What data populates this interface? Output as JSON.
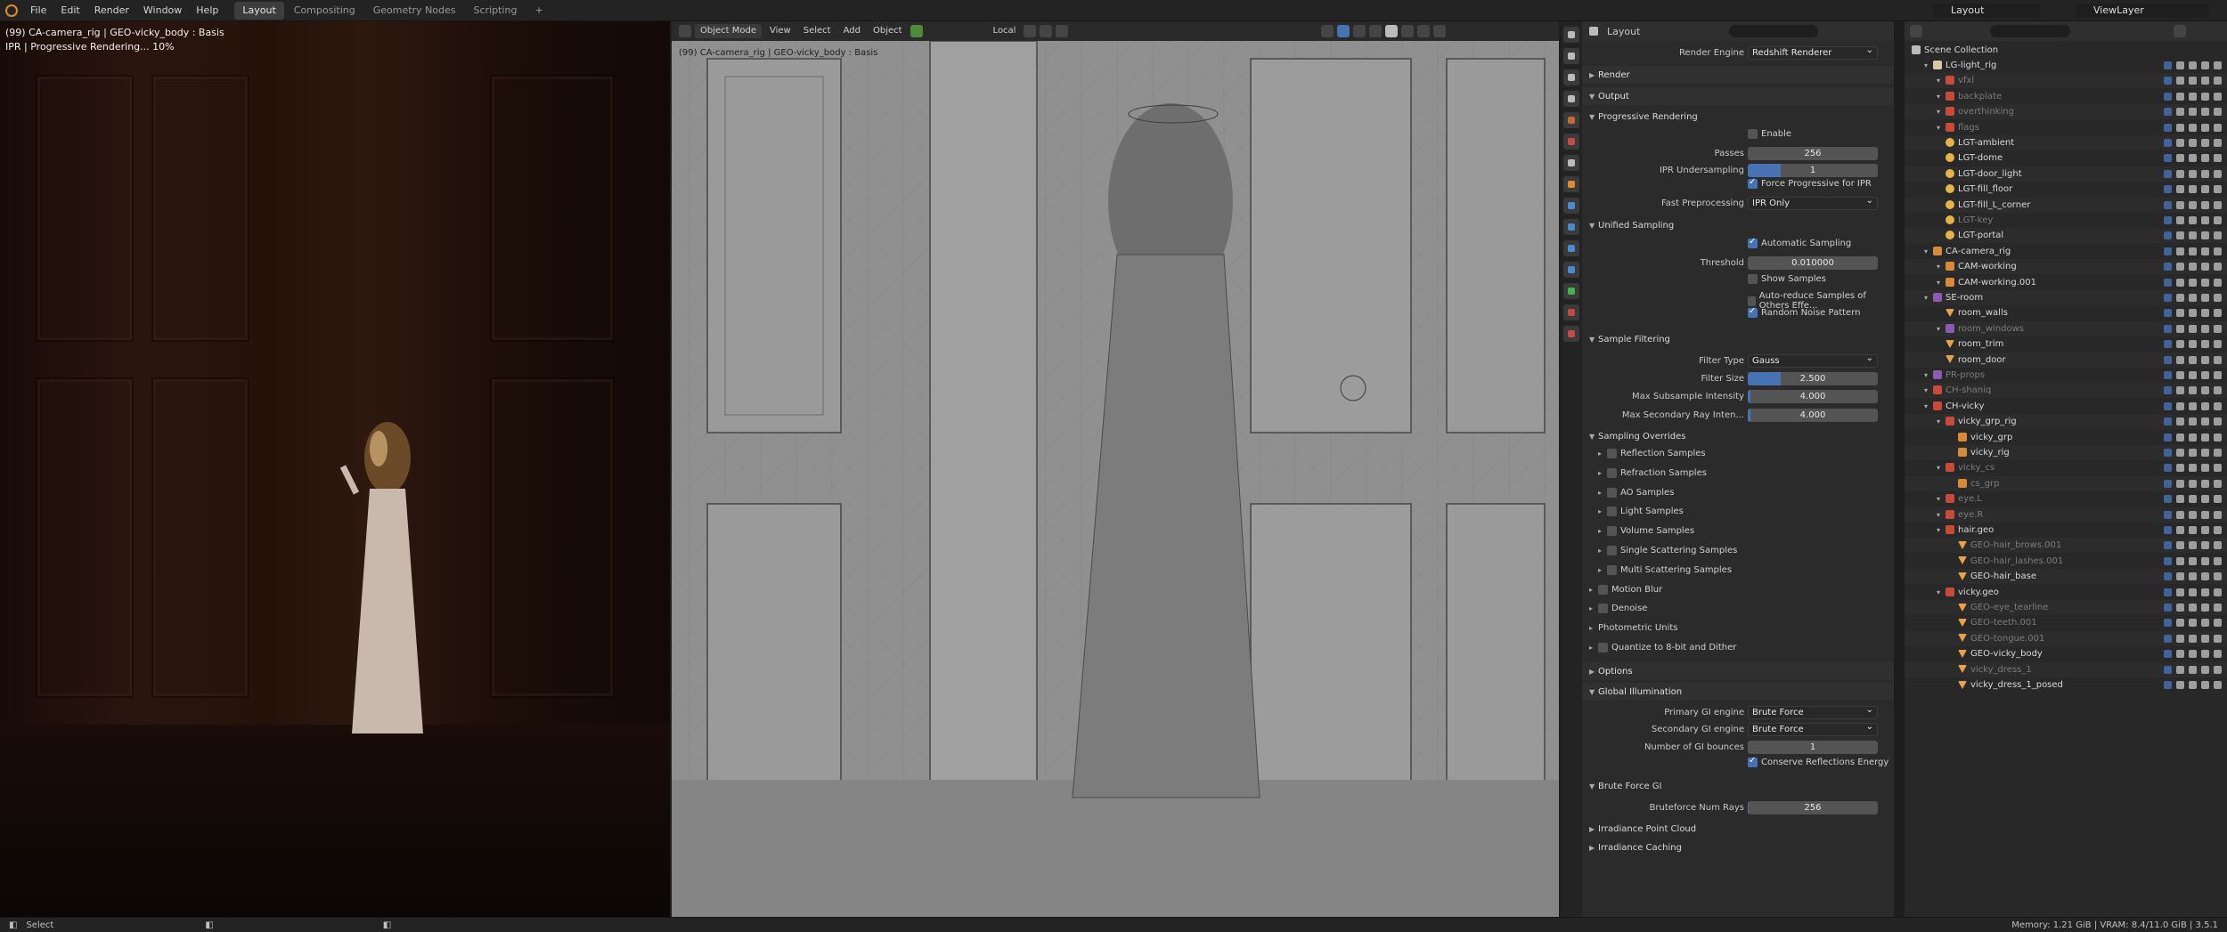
{
  "topbar": {
    "menus": [
      "File",
      "Edit",
      "Render",
      "Window",
      "Help"
    ],
    "workspaces": [
      "Layout",
      "Compositing",
      "Geometry Nodes",
      "Scripting"
    ],
    "active_workspace": "Layout",
    "add_workspace": "+",
    "scene": "Layout",
    "view_layer": "ViewLayer"
  },
  "render_view": {
    "title": "(99) CA-camera_rig | GEO-vicky_body : Basis",
    "status": "IPR | Progressive Rendering... 10%"
  },
  "viewport": {
    "mode": "Object Mode",
    "menus": [
      "View",
      "Select",
      "Add",
      "Object"
    ],
    "transform_orientation": "Local",
    "overlay_label": "(99) CA-camera_rig | GEO-vicky_body : Basis"
  },
  "properties": {
    "context": "Layout",
    "render_engine_label": "Render Engine",
    "render_engine": "Redshift Renderer",
    "panels": {
      "render": "Render",
      "output": "Output",
      "progressive": "Progressive Rendering",
      "enable": "Enable",
      "passes_label": "Passes",
      "passes": "256",
      "ipr_label": "IPR Undersampling",
      "ipr": "1",
      "force_prog": "Force Progressive for IPR",
      "fast_pre_label": "Fast Preprocessing",
      "fast_pre": "IPR Only",
      "unified": "Unified Sampling",
      "auto_sampling": "Automatic Sampling",
      "threshold_label": "Threshold",
      "threshold": "0.010000",
      "show_samples": "Show Samples",
      "auto_reduce": "Auto-reduce Samples of Others Effe...",
      "random_noise": "Random Noise Pattern",
      "sample_filtering": "Sample Filtering",
      "filter_type_label": "Filter Type",
      "filter_type": "Gauss",
      "filter_size_label": "Filter Size",
      "filter_size": "2.500",
      "filter_size_fraction": 0.25,
      "max_sub_label": "Max Subsample Intensity",
      "max_sub": "4.000",
      "max_sec_label": "Max Secondary Ray Inten...",
      "max_sec": "4.000",
      "sampling_overrides": "Sampling Overrides",
      "overrides": [
        "Reflection Samples",
        "Refraction Samples",
        "AO Samples",
        "Light Samples",
        "Volume Samples",
        "Single Scattering Samples",
        "Multi Scattering Samples"
      ],
      "motion_blur": "Motion Blur",
      "denoise": "Denoise",
      "photometric": "Photometric Units",
      "quantize": "Quantize to 8-bit and Dither",
      "options": "Options",
      "gi": "Global Illumination",
      "primary_label": "Primary GI engine",
      "primary": "Brute Force",
      "secondary_label": "Secondary GI engine",
      "secondary": "Brute Force",
      "bounces_label": "Number of GI bounces",
      "bounces": "1",
      "conserve": "Conserve Reflections Energy",
      "brute_force_gi": "Brute Force GI",
      "num_rays_label": "Bruteforce Num Rays",
      "num_rays": "256",
      "irradiance_point": "Irradiance Point Cloud",
      "irradiance_caching": "Irradiance Caching"
    }
  },
  "outliner": {
    "root": "Scene Collection",
    "rows": [
      {
        "name": "LG-light_rig",
        "indent": 1,
        "icon": "coll",
        "dim": false
      },
      {
        "name": "vfxl",
        "indent": 2,
        "icon": "red",
        "dim": true
      },
      {
        "name": "backplate",
        "indent": 2,
        "icon": "red",
        "dim": true
      },
      {
        "name": "overthinking",
        "indent": 2,
        "icon": "red",
        "dim": true
      },
      {
        "name": "flags",
        "indent": 2,
        "icon": "red",
        "dim": true
      },
      {
        "name": "LGT-ambient",
        "indent": 2,
        "icon": "light",
        "dim": false
      },
      {
        "name": "LGT-dome",
        "indent": 2,
        "icon": "light",
        "dim": false
      },
      {
        "name": "LGT-door_light",
        "indent": 2,
        "icon": "light",
        "dim": false
      },
      {
        "name": "LGT-fill_floor",
        "indent": 2,
        "icon": "light",
        "dim": false
      },
      {
        "name": "LGT-fill_L_corner",
        "indent": 2,
        "icon": "light",
        "dim": false
      },
      {
        "name": "LGT-key",
        "indent": 2,
        "icon": "light",
        "dim": true
      },
      {
        "name": "LGT-portal",
        "indent": 2,
        "icon": "light",
        "dim": false
      },
      {
        "name": "CA-camera_rig",
        "indent": 1,
        "icon": "orange",
        "dim": false
      },
      {
        "name": "CAM-working",
        "indent": 2,
        "icon": "orange",
        "dim": false
      },
      {
        "name": "CAM-working.001",
        "indent": 2,
        "icon": "orange",
        "dim": false
      },
      {
        "name": "SE-room",
        "indent": 1,
        "icon": "purple",
        "dim": false
      },
      {
        "name": "room_walls",
        "indent": 2,
        "icon": "tri",
        "dim": false
      },
      {
        "name": "room_windows",
        "indent": 2,
        "icon": "purple",
        "dim": true
      },
      {
        "name": "room_trim",
        "indent": 2,
        "icon": "tri",
        "dim": false
      },
      {
        "name": "room_door",
        "indent": 2,
        "icon": "tri",
        "dim": false
      },
      {
        "name": "PR-props",
        "indent": 1,
        "icon": "purple",
        "dim": true
      },
      {
        "name": "CH-shaniq",
        "indent": 1,
        "icon": "red",
        "dim": true
      },
      {
        "name": "CH-vicky",
        "indent": 1,
        "icon": "red",
        "dim": false
      },
      {
        "name": "vicky_grp_rig",
        "indent": 2,
        "icon": "red",
        "dim": false
      },
      {
        "name": "vicky_grp",
        "indent": 3,
        "icon": "orange",
        "dim": false
      },
      {
        "name": "vicky_rig",
        "indent": 3,
        "icon": "orange",
        "dim": false
      },
      {
        "name": "vicky_cs",
        "indent": 2,
        "icon": "red",
        "dim": true
      },
      {
        "name": "cs_grp",
        "indent": 3,
        "icon": "orange",
        "dim": true
      },
      {
        "name": "eye.L",
        "indent": 2,
        "icon": "red",
        "dim": true
      },
      {
        "name": "eye.R",
        "indent": 2,
        "icon": "red",
        "dim": true
      },
      {
        "name": "hair.geo",
        "indent": 2,
        "icon": "red",
        "dim": false
      },
      {
        "name": "GEO-hair_brows.001",
        "indent": 3,
        "icon": "tri",
        "dim": true
      },
      {
        "name": "GEO-hair_lashes.001",
        "indent": 3,
        "icon": "tri",
        "dim": true
      },
      {
        "name": "GEO-hair_base",
        "indent": 3,
        "icon": "tri",
        "dim": false
      },
      {
        "name": "vicky.geo",
        "indent": 2,
        "icon": "red",
        "dim": false
      },
      {
        "name": "GEO-eye_tearline",
        "indent": 3,
        "icon": "tri",
        "dim": true
      },
      {
        "name": "GEO-teeth.001",
        "indent": 3,
        "icon": "tri",
        "dim": true
      },
      {
        "name": "GEO-tongue.001",
        "indent": 3,
        "icon": "tri",
        "dim": true
      },
      {
        "name": "GEO-vicky_body",
        "indent": 3,
        "icon": "tri",
        "dim": false
      },
      {
        "name": "vicky_dress_1",
        "indent": 3,
        "icon": "tri",
        "dim": true
      },
      {
        "name": "vicky_dress_1_posed",
        "indent": 3,
        "icon": "tri",
        "dim": false
      }
    ]
  },
  "statusbar": {
    "left": "Select",
    "right": "Memory: 1.21 GiB | VRAM: 8.4/11.0 GiB | 3.5.1"
  }
}
